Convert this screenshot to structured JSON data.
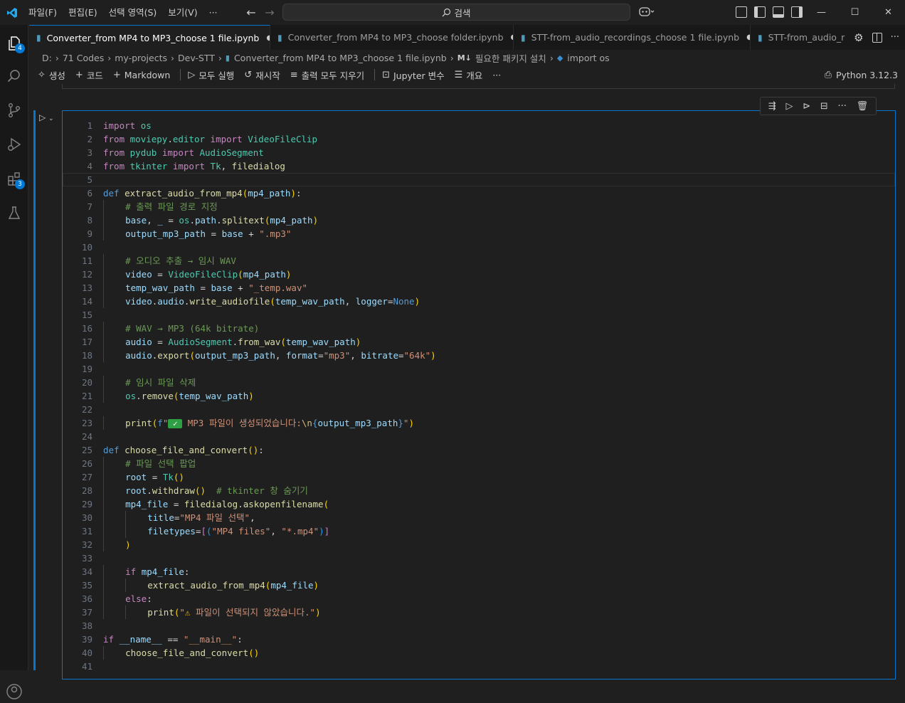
{
  "titlebar": {
    "menus": [
      "파일(F)",
      "편집(E)",
      "선택 영역(S)",
      "보기(V)",
      "···"
    ],
    "search_label": "검색"
  },
  "activity": {
    "explorer_badge": "4",
    "extensions_badge": "3"
  },
  "tabs": [
    {
      "label": "Converter_from MP4 to MP3_choose 1 file.ipynb",
      "active": true
    },
    {
      "label": "Converter_from MP4 to MP3_choose folder.ipynb",
      "active": false
    },
    {
      "label": "STT-from_audio_recordings_choose 1 file.ipynb",
      "active": false
    },
    {
      "label": "STT-from_audio_r",
      "active": false
    }
  ],
  "breadcrumb": {
    "items": [
      "D:",
      "71 Codes",
      "my-projects",
      "Dev-STT",
      "Converter_from MP4 to MP3_choose 1 file.ipynb",
      "필요한 패키지 설치",
      "import os"
    ],
    "md_prefix": "M↓"
  },
  "toolbar": {
    "generate": "생성",
    "code": "코드",
    "markdown": "Markdown",
    "run_all": "모두 실행",
    "restart": "재시작",
    "clear_outputs": "출력 모두 지우기",
    "jupyter_vars": "Jupyter 변수",
    "outline": "개요",
    "more": "···",
    "kernel": "Python 3.12.3"
  },
  "colors": {
    "accent": "#0078d4",
    "background": "#1f1f1f"
  }
}
